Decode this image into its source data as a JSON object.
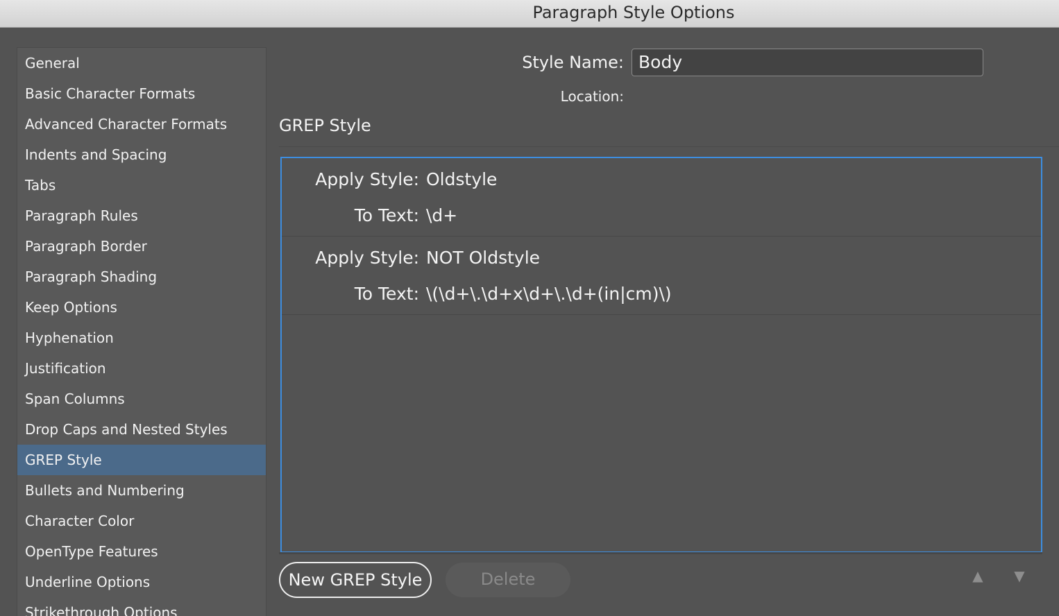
{
  "window": {
    "title": "Paragraph Style Options"
  },
  "sidebar": {
    "items": [
      {
        "label": "General"
      },
      {
        "label": "Basic Character Formats"
      },
      {
        "label": "Advanced Character Formats"
      },
      {
        "label": "Indents and Spacing"
      },
      {
        "label": "Tabs"
      },
      {
        "label": "Paragraph Rules"
      },
      {
        "label": "Paragraph Border"
      },
      {
        "label": "Paragraph Shading"
      },
      {
        "label": "Keep Options"
      },
      {
        "label": "Hyphenation"
      },
      {
        "label": "Justification"
      },
      {
        "label": "Span Columns"
      },
      {
        "label": "Drop Caps and Nested Styles"
      },
      {
        "label": "GREP Style",
        "selected": true
      },
      {
        "label": "Bullets and Numbering"
      },
      {
        "label": "Character Color"
      },
      {
        "label": "OpenType Features"
      },
      {
        "label": "Underline Options"
      },
      {
        "label": "Strikethrough Options"
      }
    ]
  },
  "header": {
    "style_name_label": "Style Name:",
    "style_name_value": "Body",
    "location_label": "Location:"
  },
  "grep": {
    "section_title": "GREP Style",
    "rules": [
      {
        "apply_label": "Apply Style:",
        "apply_value": "Oldstyle",
        "text_label": "To Text:",
        "text_value": "\\d+"
      },
      {
        "apply_label": "Apply Style:",
        "apply_value": "NOT Oldstyle",
        "text_label": "To Text:",
        "text_value": "\\(\\d+\\.\\d+x\\d+\\.\\d+(in|cm)\\)"
      }
    ],
    "new_button_label": "New GREP Style",
    "delete_button_label": "Delete",
    "move_up_icon": "▲",
    "move_down_icon": "▼"
  },
  "colors": {
    "background": "#535353",
    "selection": "#4b6a8a",
    "focus_border": "#3d8ee0"
  }
}
